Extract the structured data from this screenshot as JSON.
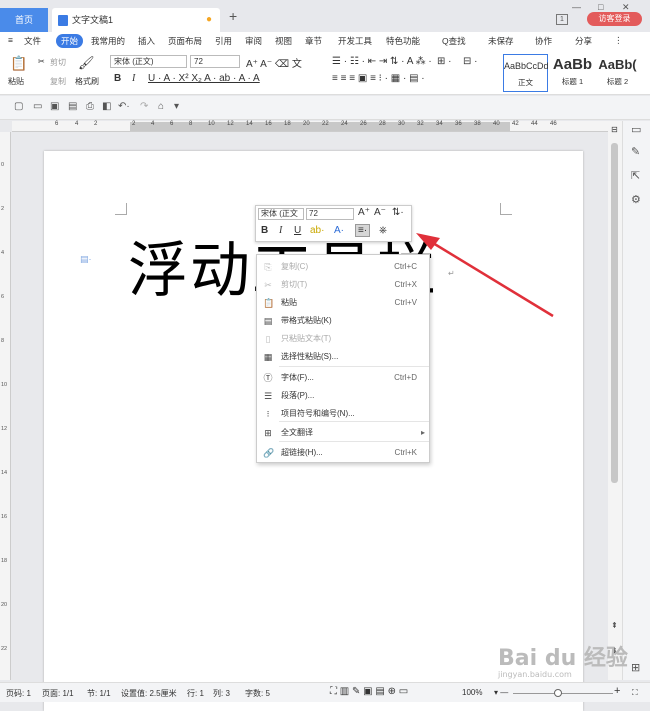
{
  "titlebar": {
    "home": "首页",
    "doc_tab": "文字文稿1",
    "login": "访客登录",
    "page_num": "1"
  },
  "menu": {
    "file": "文件",
    "items": [
      "开始",
      "我常用的",
      "插入",
      "页面布局",
      "引用",
      "审阅",
      "视图",
      "章节",
      "开发工具",
      "特色功能"
    ],
    "search": "Q查找",
    "unsaved": "未保存",
    "collab": "协作",
    "share": "分享"
  },
  "ribbon": {
    "paste": "粘贴",
    "cut": "剪切",
    "copy": "复制",
    "format_painter": "格式刷",
    "font": "宋体 (正文)",
    "size": "72",
    "styles": [
      {
        "sample": "AaBbCcDd",
        "label": "正文"
      },
      {
        "sample": "AaBb",
        "label": "标题 1"
      },
      {
        "sample": "AaBb(",
        "label": "标题 2"
      }
    ]
  },
  "ruler": {
    "ticks": [
      "6",
      "4",
      "2",
      "2",
      "4",
      "6",
      "8",
      "10",
      "12",
      "14",
      "16",
      "18",
      "20",
      "22",
      "24",
      "26",
      "28",
      "30",
      "32",
      "34",
      "36",
      "38",
      "40",
      "42",
      "44",
      "46"
    ]
  },
  "document": {
    "text": "浮动工具栏"
  },
  "minibar": {
    "font": "宋体 (正文",
    "size": "72"
  },
  "context_menu": [
    {
      "label": "复制(C)",
      "shortcut": "Ctrl+C",
      "disabled": true,
      "icon": "copy-icon"
    },
    {
      "label": "剪切(T)",
      "shortcut": "Ctrl+X",
      "disabled": true,
      "icon": "cut-icon"
    },
    {
      "label": "粘贴",
      "shortcut": "Ctrl+V",
      "disabled": false,
      "icon": "paste-icon"
    },
    {
      "label": "带格式粘贴(K)",
      "shortcut": "",
      "disabled": false,
      "icon": "paste-format-icon"
    },
    {
      "label": "只粘贴文本(T)",
      "shortcut": "",
      "disabled": true,
      "icon": "paste-text-icon"
    },
    {
      "label": "选择性粘贴(S)...",
      "shortcut": "",
      "disabled": false,
      "icon": "paste-special-icon"
    },
    {
      "label": "字体(F)...",
      "shortcut": "Ctrl+D",
      "disabled": false,
      "icon": "font-icon"
    },
    {
      "label": "段落(P)...",
      "shortcut": "",
      "disabled": false,
      "icon": "paragraph-icon"
    },
    {
      "label": "项目符号和编号(N)...",
      "shortcut": "",
      "disabled": false,
      "icon": "bullets-icon"
    },
    {
      "label": "全文翻译",
      "shortcut": "",
      "disabled": false,
      "icon": "translate-icon"
    },
    {
      "label": "超链接(H)...",
      "shortcut": "Ctrl+K",
      "disabled": false,
      "icon": "link-icon"
    }
  ],
  "status": {
    "page": "页码: 1",
    "pages": "页面: 1/1",
    "section": "节: 1/1",
    "setting": "设置值: 2.5厘米",
    "row": "行: 1",
    "col": "列: 3",
    "words": "字数: 5",
    "zoom": "100%"
  },
  "watermark": {
    "text": "Bai du 经验",
    "sub": "jingyan.baidu.com"
  },
  "colors": {
    "accent": "#3b7be4",
    "arrow": "#e0303a",
    "login": "#e35b5b"
  }
}
